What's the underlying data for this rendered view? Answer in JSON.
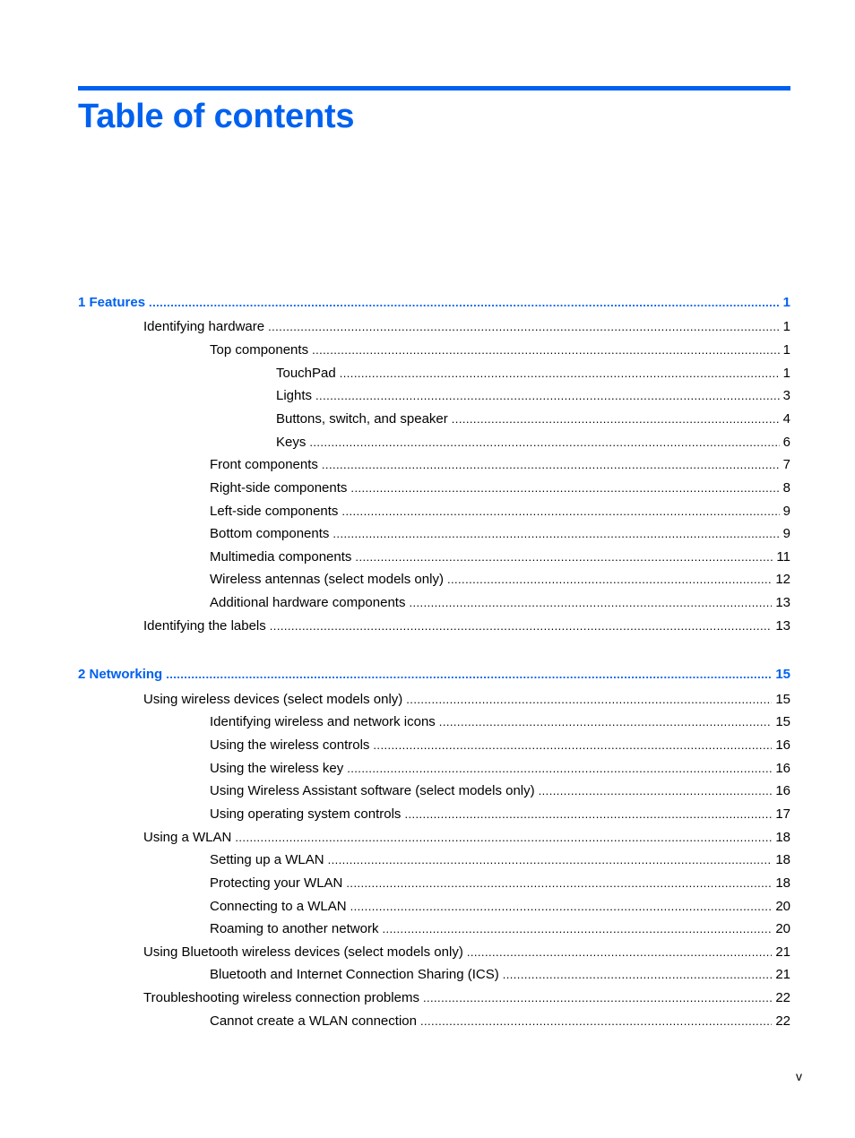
{
  "document": {
    "title": "Table of contents",
    "accent_color": "#0061f0",
    "page_number": "v"
  },
  "toc": {
    "entries": [
      {
        "level": 0,
        "label": "1  Features",
        "page": "1"
      },
      {
        "level": 1,
        "label": "Identifying hardware",
        "page": "1"
      },
      {
        "level": 2,
        "label": "Top components",
        "page": "1"
      },
      {
        "level": 3,
        "label": "TouchPad",
        "page": "1"
      },
      {
        "level": 3,
        "label": "Lights",
        "page": "3"
      },
      {
        "level": 3,
        "label": "Buttons, switch, and speaker",
        "page": "4"
      },
      {
        "level": 3,
        "label": "Keys",
        "page": "6"
      },
      {
        "level": 2,
        "label": "Front components",
        "page": "7"
      },
      {
        "level": 2,
        "label": "Right-side components",
        "page": "8"
      },
      {
        "level": 2,
        "label": "Left-side components",
        "page": "9"
      },
      {
        "level": 2,
        "label": "Bottom components",
        "page": "9"
      },
      {
        "level": 2,
        "label": "Multimedia components",
        "page": "11"
      },
      {
        "level": 2,
        "label": "Wireless antennas (select models only)",
        "page": "12"
      },
      {
        "level": 2,
        "label": "Additional hardware components",
        "page": "13"
      },
      {
        "level": 1,
        "label": "Identifying the labels",
        "page": "13"
      },
      {
        "level": 0,
        "label": "2  Networking",
        "page": "15"
      },
      {
        "level": 1,
        "label": "Using wireless devices (select models only)",
        "page": "15"
      },
      {
        "level": 2,
        "label": "Identifying wireless and network icons",
        "page": "15"
      },
      {
        "level": 2,
        "label": "Using the wireless controls",
        "page": "16"
      },
      {
        "level": 2,
        "label": "Using the wireless key",
        "page": "16"
      },
      {
        "level": 2,
        "label": "Using Wireless Assistant software (select models only)",
        "page": "16"
      },
      {
        "level": 2,
        "label": "Using operating system controls",
        "page": "17"
      },
      {
        "level": 1,
        "label": "Using a WLAN",
        "page": "18"
      },
      {
        "level": 2,
        "label": "Setting up a WLAN",
        "page": "18"
      },
      {
        "level": 2,
        "label": "Protecting your WLAN",
        "page": "18"
      },
      {
        "level": 2,
        "label": "Connecting to a WLAN",
        "page": "20"
      },
      {
        "level": 2,
        "label": "Roaming to another network",
        "page": "20"
      },
      {
        "level": 1,
        "label": "Using Bluetooth wireless devices (select models only)",
        "page": "21"
      },
      {
        "level": 2,
        "label": "Bluetooth and Internet Connection Sharing (ICS)",
        "page": "21"
      },
      {
        "level": 1,
        "label": "Troubleshooting wireless connection problems",
        "page": "22"
      },
      {
        "level": 2,
        "label": "Cannot create a WLAN connection",
        "page": "22"
      }
    ]
  }
}
